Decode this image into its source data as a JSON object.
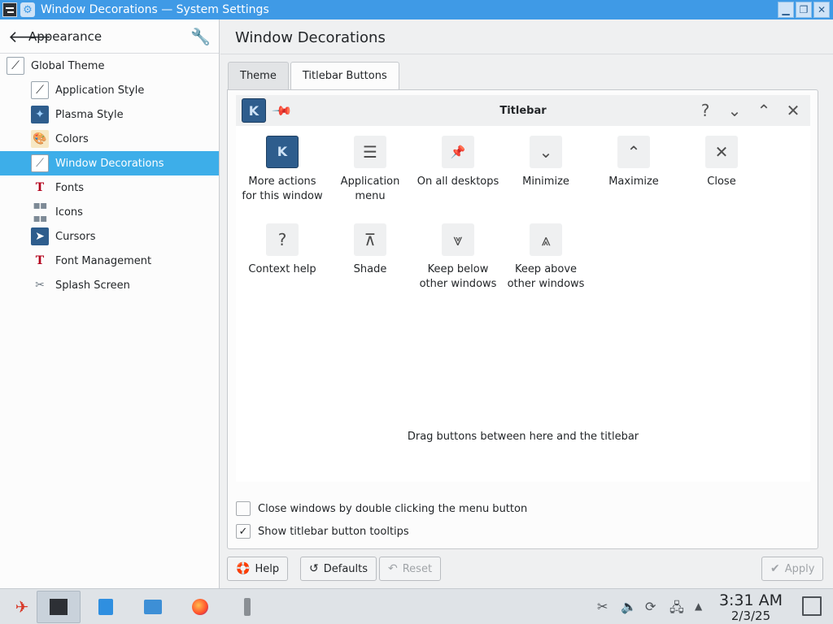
{
  "window": {
    "title": "Window Decorations — System Settings",
    "buttons": {
      "minimize": "▁",
      "maximize": "❐",
      "close": "✕"
    }
  },
  "sidebar": {
    "back_label": "Appearance",
    "items": [
      {
        "label": "Global Theme",
        "icon": "global-theme-icon"
      },
      {
        "label": "Application Style",
        "icon": "application-style-icon"
      },
      {
        "label": "Plasma Style",
        "icon": "plasma-style-icon"
      },
      {
        "label": "Colors",
        "icon": "colors-icon"
      },
      {
        "label": "Window Decorations",
        "icon": "window-decorations-icon",
        "active": true
      },
      {
        "label": "Fonts",
        "icon": "fonts-icon"
      },
      {
        "label": "Icons",
        "icon": "icons-icon"
      },
      {
        "label": "Cursors",
        "icon": "cursors-icon"
      },
      {
        "label": "Font Management",
        "icon": "font-management-icon"
      },
      {
        "label": "Splash Screen",
        "icon": "splash-screen-icon"
      }
    ]
  },
  "main": {
    "title": "Window Decorations",
    "tabs": [
      {
        "label": "Theme"
      },
      {
        "label": "Titlebar Buttons",
        "active": true
      }
    ],
    "preview": {
      "title": "Titlebar",
      "right_buttons": [
        "?",
        "⌄",
        "⌃",
        "✕"
      ]
    },
    "available_buttons": [
      {
        "label_1": "More actions",
        "label_2": "for this window",
        "glyph": "K"
      },
      {
        "label_1": "Application",
        "label_2": "menu",
        "glyph": "☰"
      },
      {
        "label_1": "On all desktops",
        "label_2": "",
        "glyph": "📌"
      },
      {
        "label_1": "Minimize",
        "label_2": "",
        "glyph": "⌄"
      },
      {
        "label_1": "Maximize",
        "label_2": "",
        "glyph": "⌃"
      },
      {
        "label_1": "Close",
        "label_2": "",
        "glyph": "✕"
      },
      {
        "label_1": "Context help",
        "label_2": "",
        "glyph": "?"
      },
      {
        "label_1": "Shade",
        "label_2": "",
        "glyph": "⊼"
      },
      {
        "label_1": "Keep below",
        "label_2": "other windows",
        "glyph": "⩔"
      },
      {
        "label_1": "Keep above",
        "label_2": "other windows",
        "glyph": "⩓"
      }
    ],
    "drag_hint": "Drag buttons between here and the titlebar",
    "options": {
      "close_double_click": {
        "label": "Close windows by double clicking the menu button",
        "checked": false
      },
      "show_tooltips": {
        "label": "Show titlebar button tooltips",
        "checked": true
      }
    },
    "footer": {
      "help": "Help",
      "defaults": "Defaults",
      "reset": "Reset",
      "apply": "Apply"
    }
  },
  "taskbar": {
    "time": "3:31 AM",
    "date": "2/3/25"
  }
}
